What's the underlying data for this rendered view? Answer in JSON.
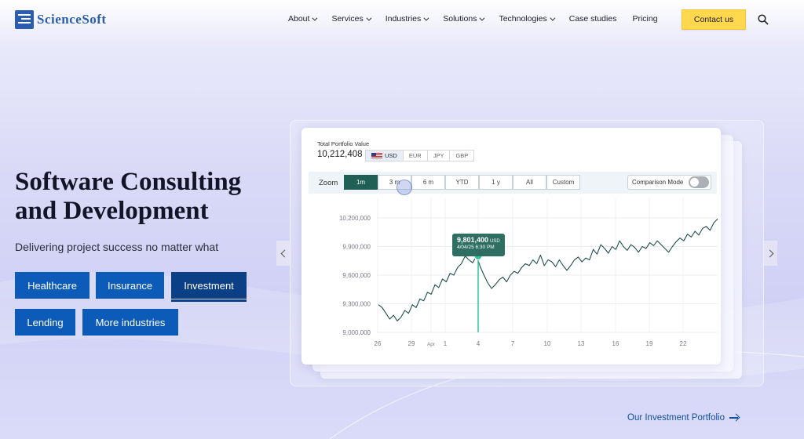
{
  "header": {
    "logo_text": "ScienceSoft",
    "nav": [
      {
        "label": "About",
        "dropdown": true
      },
      {
        "label": "Services",
        "dropdown": true
      },
      {
        "label": "Industries",
        "dropdown": true
      },
      {
        "label": "Solutions",
        "dropdown": true
      },
      {
        "label": "Technologies",
        "dropdown": true
      },
      {
        "label": "Case studies",
        "dropdown": false
      },
      {
        "label": "Pricing",
        "dropdown": false
      }
    ],
    "contact_label": "Contact us",
    "accent_color": "#ffd84d",
    "brand_color": "#2a5db0"
  },
  "hero": {
    "title_line1": "Software Consulting",
    "title_line2": "and Development",
    "subtitle": "Delivering project success no matter what",
    "industries": [
      {
        "label": "Healthcare",
        "active": false
      },
      {
        "label": "Insurance",
        "active": false
      },
      {
        "label": "Investment",
        "active": true
      },
      {
        "label": "Lending",
        "active": false
      },
      {
        "label": "More industries",
        "active": false
      }
    ]
  },
  "widget": {
    "portfolio_label": "Total Portfolio Value",
    "portfolio_value": "10,212,408",
    "currencies": [
      "USD",
      "EUR",
      "JPY",
      "GBP"
    ],
    "selected_currency": "USD",
    "zoom_label": "Zoom",
    "zoom_options": [
      "1m",
      "3 m",
      "6 m",
      "YTD",
      "1 y",
      "All",
      "Custom"
    ],
    "selected_zoom": "1m",
    "comparison_label": "Comparison Mode",
    "comparison_on": false,
    "tooltip_value": "9,801,400",
    "tooltip_currency": "USD",
    "tooltip_date": "4/04/25  6:30 PM"
  },
  "chart_data": {
    "type": "line",
    "title": "",
    "xlabel": "",
    "ylabel": "",
    "y_ticks": [
      "10,200,000",
      "9,900,000",
      "9,600,000",
      "9,300,000",
      "9,000,000"
    ],
    "y_tick_values": [
      10200000,
      9900000,
      9600000,
      9300000,
      9000000
    ],
    "x_ticks": [
      "26",
      "29",
      "Apr",
      "1",
      "4",
      "7",
      "10",
      "13",
      "16",
      "19",
      "22"
    ],
    "ylim": [
      9000000,
      10200000
    ],
    "grid": true,
    "line_color": "#1f4f4a",
    "highlight_color": "#2ec49a",
    "highlight_point": {
      "x": "4",
      "y": 9801400
    },
    "x": [
      0,
      1,
      2,
      3,
      4,
      5,
      6,
      7,
      8,
      9,
      10,
      11,
      12,
      13,
      14,
      15,
      16,
      17,
      18,
      19,
      20,
      21,
      22,
      23,
      24,
      25,
      26,
      27,
      28,
      29,
      30,
      31,
      32,
      33,
      34,
      35,
      36,
      37,
      38,
      39,
      40,
      41,
      42,
      43,
      44,
      45,
      46,
      47,
      48,
      49,
      50,
      51,
      52,
      53,
      54,
      55,
      56,
      57,
      58,
      59,
      60,
      61,
      62,
      63,
      64,
      65,
      66,
      67,
      68,
      69,
      70,
      71,
      72,
      73,
      74,
      75,
      76,
      77,
      78,
      79,
      80,
      81,
      82,
      83,
      84,
      85,
      86,
      87,
      88,
      89,
      90
    ],
    "values": [
      9290000,
      9260000,
      9200000,
      9140000,
      9180000,
      9120000,
      9160000,
      9230000,
      9200000,
      9290000,
      9260000,
      9350000,
      9330000,
      9420000,
      9400000,
      9500000,
      9470000,
      9560000,
      9530000,
      9620000,
      9600000,
      9680000,
      9720000,
      9800000,
      9760000,
      9730000,
      9800000,
      9690000,
      9600000,
      9520000,
      9460000,
      9500000,
      9550000,
      9580000,
      9530000,
      9600000,
      9640000,
      9620000,
      9680000,
      9720000,
      9700000,
      9760000,
      9720000,
      9810000,
      9700000,
      9760000,
      9740000,
      9690000,
      9760000,
      9700000,
      9650000,
      9700000,
      9760000,
      9790000,
      9740000,
      9780000,
      9760000,
      9870000,
      9820000,
      9920000,
      9880000,
      9830000,
      9900000,
      9870000,
      9960000,
      9900000,
      9860000,
      9920000,
      9890000,
      9840000,
      9900000,
      9880000,
      9940000,
      9910000,
      9960000,
      9920000,
      9880000,
      9840000,
      9900000,
      9950000,
      9990000,
      9960000,
      10030000,
      10000000,
      10060000,
      10020000,
      10090000,
      10110000,
      10070000,
      10150000,
      10190000
    ]
  },
  "carousel": {
    "link_label": "Our Investment Portfolio"
  }
}
